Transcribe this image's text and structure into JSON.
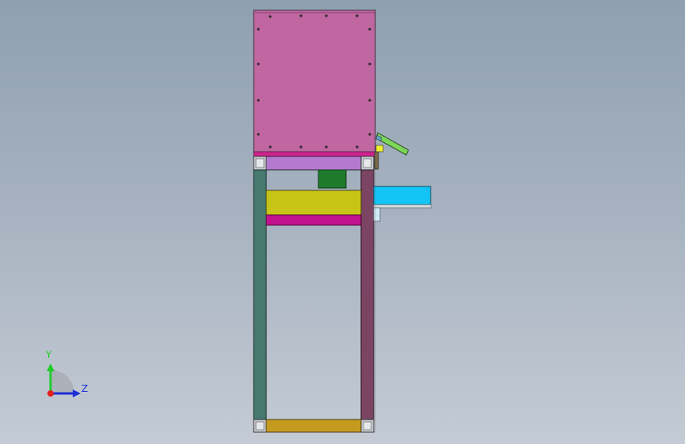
{
  "viewport": {
    "background_top": "#8fa0b1",
    "background_bottom": "#c4cbd4"
  },
  "model": {
    "parts": {
      "cabinet_panel_color": "#c066a0",
      "top_rail_color": "#b37ad0",
      "left_leg_color": "#467a70",
      "right_leg_color": "#7a4462",
      "yellow_beam_color": "#c8c417",
      "magenta_beam_color": "#c1118f",
      "bottom_rail_color": "#c49a1f",
      "green_block_color": "#1f7a2c",
      "cyan_tray_color": "#14c4f4",
      "sensor_bracket_color": "#7cd65a"
    }
  },
  "triad": {
    "y_label": "Y",
    "z_label": "Z",
    "y_color": "#1fcc2a",
    "z_color": "#1f2fd8",
    "x_color": "#e0201e"
  }
}
